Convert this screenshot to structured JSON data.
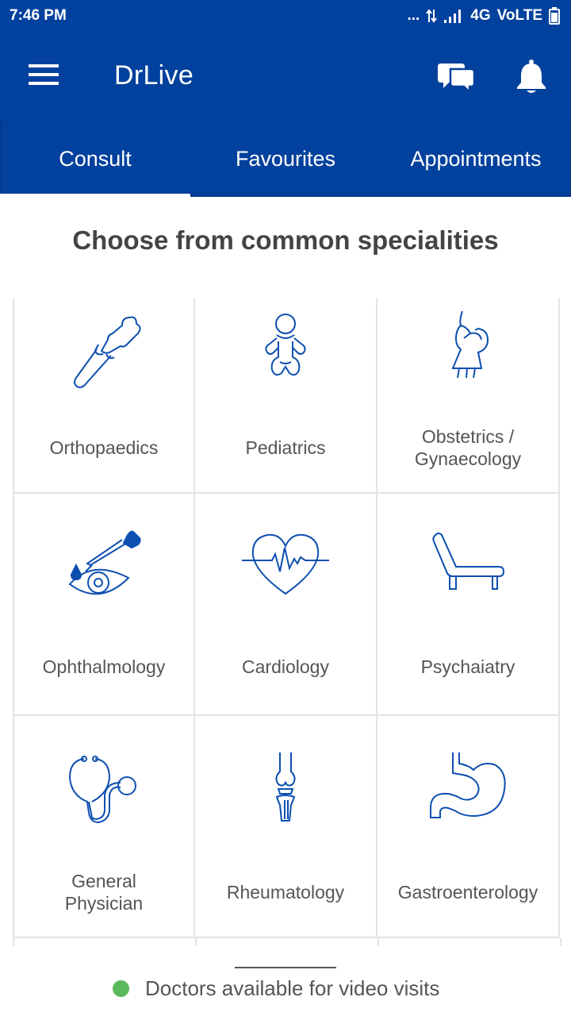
{
  "status_bar": {
    "time": "7:46 PM",
    "dots": "...",
    "network": "4G",
    "volte": "VoLTE"
  },
  "app_bar": {
    "title": "DrLive"
  },
  "tabs": [
    {
      "label": "Consult",
      "active": true
    },
    {
      "label": "Favourites",
      "active": false
    },
    {
      "label": "Appointments",
      "active": false
    }
  ],
  "heading": "Choose from common specialities",
  "specialities": [
    {
      "label": "Orthopaedics",
      "icon": "bone-joint-icon"
    },
    {
      "label": "Pediatrics",
      "icon": "baby-icon"
    },
    {
      "label": "Obstetrics / Gynaecology",
      "icon": "pregnant-woman-icon"
    },
    {
      "label": "Ophthalmology",
      "icon": "eye-dropper-icon"
    },
    {
      "label": "Cardiology",
      "icon": "heartbeat-icon"
    },
    {
      "label": "Psychaiatry",
      "icon": "couch-icon"
    },
    {
      "label": "General Physician",
      "icon": "stethoscope-icon"
    },
    {
      "label": "Rheumatology",
      "icon": "knee-joint-icon"
    },
    {
      "label": "Gastroenterology",
      "icon": "stomach-icon"
    }
  ],
  "bottom": {
    "availability_text": "Doctors available for video visits"
  },
  "colors": {
    "primary": "#02419d",
    "icon": "#0d4fb0",
    "available": "#5cb85c"
  }
}
